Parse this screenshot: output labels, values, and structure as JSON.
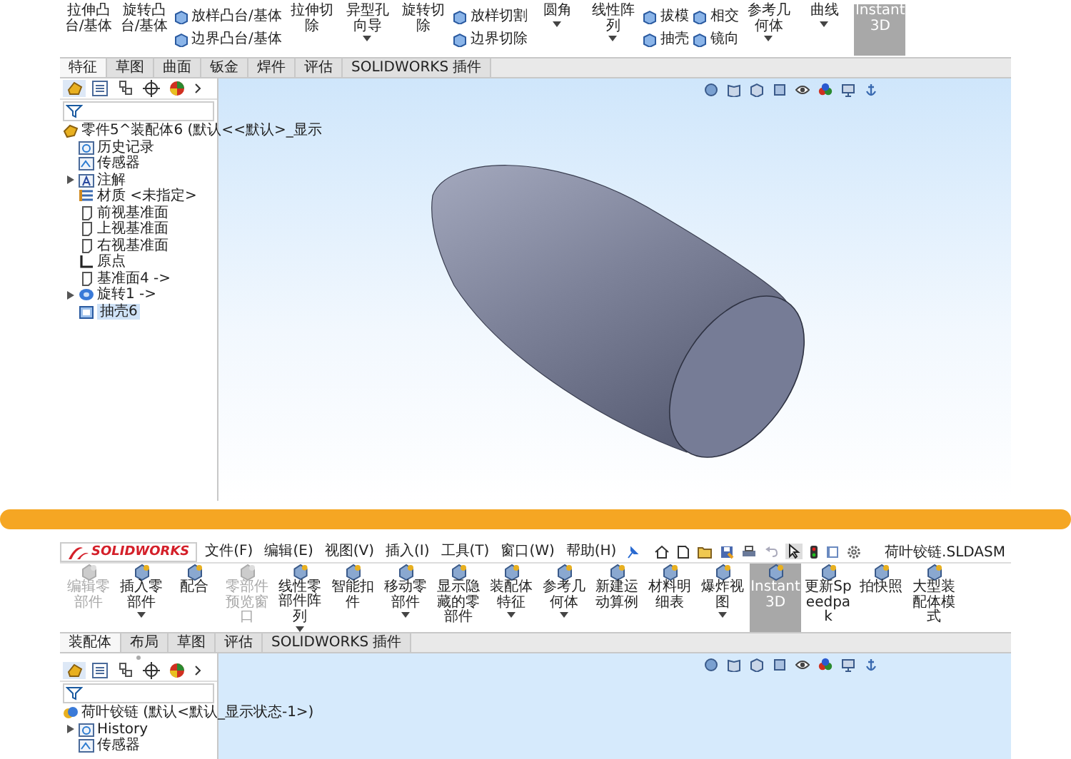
{
  "top_window": {
    "ribbon": [
      {
        "kind": "large",
        "label": "拉伸凸台/基体",
        "dropdown": false,
        "selected": false
      },
      {
        "kind": "large",
        "label": "旋转凸台/基体",
        "dropdown": false,
        "selected": false
      },
      {
        "kind": "stack",
        "items": [
          {
            "label": "放样凸台/基体"
          },
          {
            "label": "边界凸台/基体"
          }
        ],
        "selected": false
      },
      {
        "kind": "large",
        "label": "拉伸切除",
        "dropdown": false,
        "selected": false
      },
      {
        "kind": "large",
        "label": "异型孔向导",
        "dropdown": true,
        "selected": false
      },
      {
        "kind": "large",
        "label": "旋转切除",
        "dropdown": false,
        "selected": false
      },
      {
        "kind": "stack",
        "items": [
          {
            "label": "放样切割"
          },
          {
            "label": "边界切除"
          }
        ],
        "selected": false
      },
      {
        "kind": "large",
        "label": "圆角",
        "dropdown": true,
        "selected": false
      },
      {
        "kind": "large",
        "label": "线性阵列",
        "dropdown": true,
        "selected": false
      },
      {
        "kind": "stack",
        "items": [
          {
            "label": "拔模"
          },
          {
            "label": "抽壳"
          }
        ],
        "selected": false
      },
      {
        "kind": "stack",
        "items": [
          {
            "label": "相交"
          },
          {
            "label": "镜向"
          }
        ],
        "selected": false
      },
      {
        "kind": "large",
        "label": "参考几何体",
        "dropdown": true,
        "selected": false
      },
      {
        "kind": "large",
        "label": "曲线",
        "dropdown": true,
        "selected": false
      },
      {
        "kind": "large",
        "label": "Instant3D",
        "dropdown": false,
        "selected": true
      }
    ],
    "tabs": [
      {
        "label": "特征",
        "selected": true
      },
      {
        "label": "草图",
        "selected": false
      },
      {
        "label": "曲面",
        "selected": false
      },
      {
        "label": "钣金",
        "selected": false
      },
      {
        "label": "焊件",
        "selected": false
      },
      {
        "label": "评估",
        "selected": false
      },
      {
        "label": "SOLIDWORKS 插件",
        "selected": false
      }
    ],
    "tree": {
      "root": {
        "kind": "part",
        "label": "零件5^装配体6 (默认<<默认>_显示"
      },
      "items": [
        {
          "kind": "history",
          "label": "历史记录",
          "expandable": false,
          "selected": false
        },
        {
          "kind": "sensor",
          "label": "传感器",
          "expandable": false,
          "selected": false
        },
        {
          "kind": "annotation",
          "label": "注解",
          "expandable": true,
          "selected": false
        },
        {
          "kind": "material",
          "label": "材质 <未指定>",
          "expandable": false,
          "selected": false
        },
        {
          "kind": "plane",
          "label": "前视基准面",
          "expandable": false,
          "selected": false
        },
        {
          "kind": "plane",
          "label": "上视基准面",
          "expandable": false,
          "selected": false
        },
        {
          "kind": "plane",
          "label": "右视基准面",
          "expandable": false,
          "selected": false
        },
        {
          "kind": "origin",
          "label": "原点",
          "expandable": false,
          "selected": false
        },
        {
          "kind": "plane",
          "label": "基准面4 ->",
          "expandable": false,
          "selected": false
        },
        {
          "kind": "revolve",
          "label": "旋转1 ->",
          "expandable": true,
          "selected": false
        },
        {
          "kind": "shell",
          "label": "抽壳6",
          "expandable": false,
          "selected": true
        }
      ]
    }
  },
  "bottom_window": {
    "logo": "SOLIDWORKS",
    "menus": [
      "文件(F)",
      "编辑(E)",
      "视图(V)",
      "插入(I)",
      "工具(T)",
      "窗口(W)",
      "帮助(H)"
    ],
    "filename": "荷叶铰链.SLDASM",
    "ribbon": [
      {
        "label": "编辑零部件",
        "dropdown": false,
        "disabled": true,
        "selected": false
      },
      {
        "label": "插入零部件",
        "dropdown": true,
        "disabled": false,
        "selected": false
      },
      {
        "label": "配合",
        "dropdown": false,
        "disabled": false,
        "selected": false
      },
      {
        "label": "零部件预览窗口",
        "dropdown": false,
        "disabled": true,
        "selected": false
      },
      {
        "label": "线性零部件阵列",
        "dropdown": true,
        "disabled": false,
        "selected": false
      },
      {
        "label": "智能扣件",
        "dropdown": false,
        "disabled": false,
        "selected": false
      },
      {
        "label": "移动零部件",
        "dropdown": true,
        "disabled": false,
        "selected": false
      },
      {
        "label": "显示隐藏的零部件",
        "dropdown": false,
        "disabled": false,
        "selected": false
      },
      {
        "label": "装配体特征",
        "dropdown": true,
        "disabled": false,
        "selected": false
      },
      {
        "label": "参考几何体",
        "dropdown": true,
        "disabled": false,
        "selected": false
      },
      {
        "label": "新建运动算例",
        "dropdown": false,
        "disabled": false,
        "selected": false
      },
      {
        "label": "材料明细表",
        "dropdown": false,
        "disabled": false,
        "selected": false
      },
      {
        "label": "爆炸视图",
        "dropdown": true,
        "disabled": false,
        "selected": false
      },
      {
        "label": "Instant3D",
        "dropdown": false,
        "disabled": false,
        "selected": true
      },
      {
        "label": "更新Speedpak",
        "dropdown": false,
        "disabled": false,
        "selected": false
      },
      {
        "label": "拍快照",
        "dropdown": false,
        "disabled": false,
        "selected": false
      },
      {
        "label": "大型装配体模式",
        "dropdown": false,
        "disabled": false,
        "selected": false
      }
    ],
    "tabs": [
      {
        "label": "装配体",
        "selected": true
      },
      {
        "label": "布局",
        "selected": false
      },
      {
        "label": "草图",
        "selected": false
      },
      {
        "label": "评估",
        "selected": false
      },
      {
        "label": "SOLIDWORKS 插件",
        "selected": false
      }
    ],
    "tree": {
      "root": {
        "kind": "assembly",
        "label": "荷叶铰链 (默认<默认_显示状态-1>)"
      },
      "items": [
        {
          "kind": "history",
          "label": "History",
          "expandable": true,
          "selected": false
        },
        {
          "kind": "sensor",
          "label": "传感器",
          "expandable": false,
          "selected": false
        }
      ]
    }
  }
}
